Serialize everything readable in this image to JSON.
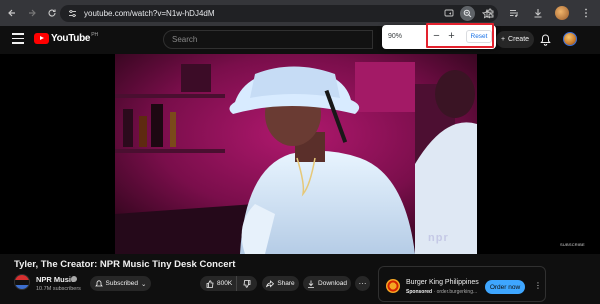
{
  "browser": {
    "url": "youtube.com/watch?v=N1w-hDJ4dM",
    "icons": [
      "back-icon",
      "forward-icon",
      "reload-icon",
      "site-info-icon",
      "cast-icon",
      "zoom-icon",
      "bookmark-star-icon",
      "extensions-icon",
      "media-icon",
      "download-icon",
      "profile-avatar",
      "menu-icon"
    ]
  },
  "zoom_popup": {
    "level": "90%",
    "minus": "−",
    "plus": "+",
    "reset": "Reset",
    "highlight_color": "#e3222e"
  },
  "youtube_header": {
    "logo": "YouTube",
    "logo_country": "PH",
    "search_placeholder": "Search",
    "create_label": "Create"
  },
  "video": {
    "title": "Tyler, The Creator: NPR Music Tiny Desk Concert",
    "watermark": "npr",
    "subscribe_mark": "SUBSCRIBE"
  },
  "channel": {
    "name": "NPR Music",
    "subscribers": "10.7M subscribers",
    "subscribed_label": "Subscribed"
  },
  "actions": {
    "likes": "800K",
    "share": "Share",
    "download": "Download",
    "more": "···"
  },
  "ad": {
    "title": "Burger King Philippines",
    "sponsored": "Sponsored",
    "domain": "· order.burgerking...",
    "cta": "Order now",
    "more": "⋮"
  },
  "colors": {
    "accent": "#3ea6ff",
    "youtube_red": "#ff0000",
    "background": "#0f0f0f"
  }
}
